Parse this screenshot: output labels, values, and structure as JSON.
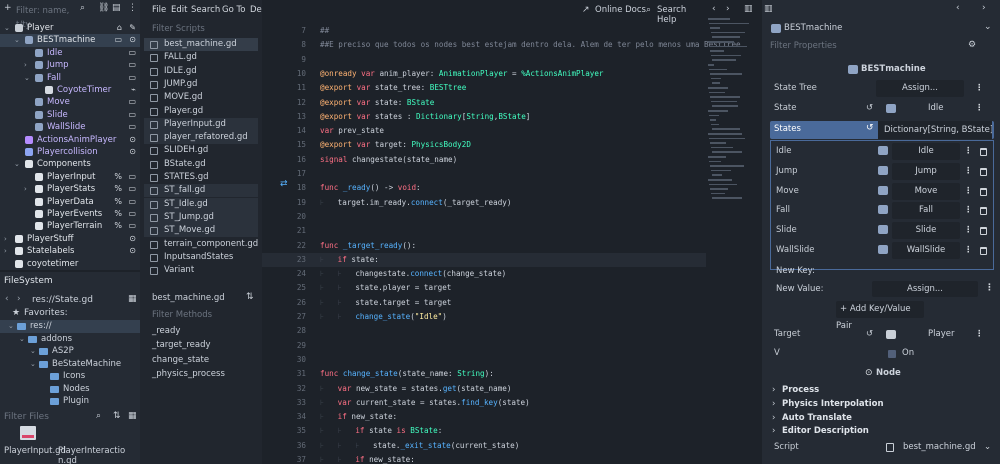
{
  "scene": {
    "filter_placeholder": "Filter: name, t/ty",
    "nodes": [
      {
        "label": "Player",
        "depth": 0,
        "color": "#e1e5ea",
        "icon": "#c9cfd7",
        "right": "✎",
        "right2": "⌂",
        "sel": false,
        "arrow": "⌄"
      },
      {
        "label": "BESTmachine",
        "depth": 1,
        "color": "#e1e5ea",
        "icon": "#8fa4c4",
        "right": "⊙",
        "right2": "▭",
        "sel": true,
        "arrow": "⌄"
      },
      {
        "label": "Idle",
        "depth": 2,
        "color": "#c7b8ff",
        "icon": "#8fa4c4",
        "right": "▭",
        "right2": "",
        "sel": false,
        "arrow": ""
      },
      {
        "label": "Jump",
        "depth": 2,
        "color": "#c7b8ff",
        "icon": "#8fa4c4",
        "right": "▭",
        "right2": "",
        "sel": false,
        "arrow": "›"
      },
      {
        "label": "Fall",
        "depth": 2,
        "color": "#c7b8ff",
        "icon": "#8fa4c4",
        "right": "▭",
        "right2": "",
        "sel": false,
        "arrow": "⌄"
      },
      {
        "label": "CoyoteTimer",
        "depth": 3,
        "color": "#c7b8ff",
        "icon": "#d6dbe2",
        "right": "⌁",
        "right2": "",
        "sel": false,
        "arrow": ""
      },
      {
        "label": "Move",
        "depth": 2,
        "color": "#c7b8ff",
        "icon": "#8fa4c4",
        "right": "▭",
        "right2": "",
        "sel": false,
        "arrow": ""
      },
      {
        "label": "Slide",
        "depth": 2,
        "color": "#c7b8ff",
        "icon": "#8fa4c4",
        "right": "▭",
        "right2": "",
        "sel": false,
        "arrow": ""
      },
      {
        "label": "WallSlide",
        "depth": 2,
        "color": "#c7b8ff",
        "icon": "#8fa4c4",
        "right": "▭",
        "right2": "",
        "sel": false,
        "arrow": ""
      },
      {
        "label": "ActionsAnimPlayer",
        "depth": 1,
        "color": "#c7b8ff",
        "icon": "#b58cff",
        "right": "⊙",
        "right2": "",
        "sel": false,
        "arrow": ""
      },
      {
        "label": "Playercollision",
        "depth": 1,
        "color": "#c7b8ff",
        "icon": "#8da5f3",
        "right": "⊙",
        "right2": "",
        "sel": false,
        "arrow": ""
      },
      {
        "label": "Components",
        "depth": 1,
        "color": "#e1e5ea",
        "icon": "#e1e5ea",
        "right": "",
        "right2": "",
        "sel": false,
        "arrow": "⌄"
      },
      {
        "label": "PlayerInput",
        "depth": 2,
        "color": "#e1e5ea",
        "icon": "#e1e5ea",
        "right": "▭",
        "right2": "%",
        "sel": false,
        "arrow": ""
      },
      {
        "label": "PlayerStats",
        "depth": 2,
        "color": "#e1e5ea",
        "icon": "#e1e5ea",
        "right": "▭",
        "right2": "%",
        "sel": false,
        "arrow": "›"
      },
      {
        "label": "PlayerData",
        "depth": 2,
        "color": "#e1e5ea",
        "icon": "#e1e5ea",
        "right": "▭",
        "right2": "%",
        "sel": false,
        "arrow": ""
      },
      {
        "label": "PlayerEvents",
        "depth": 2,
        "color": "#e1e5ea",
        "icon": "#e1e5ea",
        "right": "▭",
        "right2": "%",
        "sel": false,
        "arrow": ""
      },
      {
        "label": "PlayerTerrain",
        "depth": 2,
        "color": "#e1e5ea",
        "icon": "#e1e5ea",
        "right": "▭",
        "right2": "%",
        "sel": false,
        "arrow": ""
      },
      {
        "label": "PlayerStuff",
        "depth": 0,
        "color": "#e1e5ea",
        "icon": "#e1e5ea",
        "right": "⊙",
        "right2": "",
        "sel": false,
        "arrow": "›"
      },
      {
        "label": "Statelabels",
        "depth": 0,
        "color": "#e1e5ea",
        "icon": "#e1e5ea",
        "right": "⊙",
        "right2": "",
        "sel": false,
        "arrow": "›"
      },
      {
        "label": "coyotetimer",
        "depth": 0,
        "color": "#e1e5ea",
        "icon": "#e1e5ea",
        "right": "",
        "right2": "",
        "sel": false,
        "arrow": ""
      }
    ]
  },
  "filesystem": {
    "title": "FileSystem",
    "path": "res://State.gd",
    "favorites": "Favorites:",
    "entries": [
      {
        "label": "res://",
        "depth": 0,
        "sel": true
      },
      {
        "label": "addons",
        "depth": 1,
        "sel": false
      },
      {
        "label": "AS2P",
        "depth": 2,
        "sel": false
      },
      {
        "label": "BeStateMachine",
        "depth": 2,
        "sel": false
      },
      {
        "label": "Icons",
        "depth": 3,
        "sel": false
      },
      {
        "label": "Nodes",
        "depth": 3,
        "sel": false
      },
      {
        "label": "Plugin",
        "depth": 3,
        "sel": false
      }
    ],
    "filter_placeholder": "Filter Files",
    "thumbs": [
      "PlayerInput.gd",
      "PlayerInteractio n.gd"
    ]
  },
  "menu": [
    "File",
    "Edit",
    "Search",
    "Go To",
    "Debug"
  ],
  "top_right": {
    "online_docs": "Online Docs",
    "search_help": "Search Help"
  },
  "scripts": {
    "filter_placeholder": "Filter Scripts",
    "items": [
      "best_machine.gd",
      "FALL.gd",
      "IDLE.gd",
      "JUMP.gd",
      "MOVE.gd",
      "Player.gd",
      "PlayerInput.gd",
      "player_refatored.gd",
      "SLIDEH.gd",
      "BState.gd",
      "STATES.gd",
      "ST_fall.gd",
      "ST_Idle.gd",
      "ST_Jump.gd",
      "ST_Move.gd",
      "terrain_component.gd",
      "InputsandStates",
      "Variant"
    ],
    "current": "best_machine.gd",
    "methods_placeholder": "Filter Methods",
    "methods": [
      "_ready",
      "_target_ready",
      "change_state",
      "_physics_process"
    ]
  },
  "code": [
    {
      "n": "7",
      "t": [
        [
          "cm",
          "##"
        ]
      ]
    },
    {
      "n": "8",
      "t": [
        [
          "cm",
          "##E preciso que todos os nodes best estejam dentro dela. Alem de ter pelo menos uma BestTree"
        ]
      ]
    },
    {
      "n": "9",
      "t": []
    },
    {
      "n": "10",
      "t": [
        [
          "ann",
          "@onready"
        ],
        [
          "",
          " "
        ],
        [
          "kw",
          "var"
        ],
        [
          "",
          " anim_player: "
        ],
        [
          "ty",
          "AnimationPlayer"
        ],
        [
          "",
          " = "
        ],
        [
          "ty",
          "%ActionsAnimPlayer"
        ]
      ]
    },
    {
      "n": "11",
      "t": [
        [
          "ann",
          "@export"
        ],
        [
          "",
          " "
        ],
        [
          "kw",
          "var"
        ],
        [
          "",
          " state_tree: "
        ],
        [
          "ty",
          "BESTtree"
        ]
      ]
    },
    {
      "n": "12",
      "t": [
        [
          "ann",
          "@export"
        ],
        [
          "",
          " "
        ],
        [
          "kw",
          "var"
        ],
        [
          "",
          " state: "
        ],
        [
          "ty",
          "BState"
        ]
      ]
    },
    {
      "n": "13",
      "t": [
        [
          "ann",
          "@export"
        ],
        [
          "",
          " "
        ],
        [
          "kw",
          "var"
        ],
        [
          "",
          " states : "
        ],
        [
          "ty",
          "Dictionary"
        ],
        [
          "",
          "["
        ],
        [
          "ty",
          "String"
        ],
        [
          "",
          ","
        ],
        [
          "ty",
          "BState"
        ],
        [
          "",
          "]"
        ]
      ]
    },
    {
      "n": "14",
      "t": [
        [
          "kw",
          "var"
        ],
        [
          "",
          " prev_state"
        ]
      ]
    },
    {
      "n": "15",
      "t": [
        [
          "ann",
          "@export"
        ],
        [
          "",
          " "
        ],
        [
          "kw",
          "var"
        ],
        [
          "",
          " target: "
        ],
        [
          "ty",
          "PhysicsBody2D"
        ]
      ]
    },
    {
      "n": "16",
      "t": [
        [
          "kw",
          "signal"
        ],
        [
          "",
          " changestate(state_name)"
        ]
      ]
    },
    {
      "n": "17",
      "t": []
    },
    {
      "n": "18",
      "t": [
        [
          "kw",
          "func"
        ],
        [
          "",
          " "
        ],
        [
          "fn",
          "_ready"
        ],
        [
          "",
          "() -> "
        ],
        [
          "kw",
          "void"
        ],
        [
          "",
          ":"
        ]
      ]
    },
    {
      "n": "19",
      "t": [
        [
          "tab",
          "⊦   "
        ],
        [
          "",
          "target.im_ready."
        ],
        [
          "fn",
          "connect"
        ],
        [
          "",
          "(_target_ready)"
        ]
      ]
    },
    {
      "n": "20",
      "t": []
    },
    {
      "n": "21",
      "t": []
    },
    {
      "n": "22",
      "t": [
        [
          "kw",
          "func"
        ],
        [
          "",
          " "
        ],
        [
          "fn",
          "_target_ready"
        ],
        [
          "",
          "():"
        ]
      ]
    },
    {
      "n": "23",
      "t": [
        [
          "tab",
          "⊦   "
        ],
        [
          "kw",
          "if"
        ],
        [
          "",
          " state:"
        ]
      ],
      "cur": true
    },
    {
      "n": "24",
      "t": [
        [
          "tab",
          "⊦   ⊦   "
        ],
        [
          "",
          "changestate."
        ],
        [
          "fn",
          "connect"
        ],
        [
          "",
          "(change_state)"
        ]
      ]
    },
    {
      "n": "25",
      "t": [
        [
          "tab",
          "⊦   ⊦   "
        ],
        [
          "",
          "state.player = target"
        ]
      ]
    },
    {
      "n": "26",
      "t": [
        [
          "tab",
          "⊦   ⊦   "
        ],
        [
          "",
          "state.target = target"
        ]
      ]
    },
    {
      "n": "27",
      "t": [
        [
          "tab",
          "⊦   ⊦   "
        ],
        [
          "fn",
          "change_state"
        ],
        [
          "",
          "("
        ],
        [
          "str",
          "\"Idle\""
        ],
        [
          "",
          ")"
        ]
      ]
    },
    {
      "n": "28",
      "t": []
    },
    {
      "n": "29",
      "t": []
    },
    {
      "n": "30",
      "t": []
    },
    {
      "n": "31",
      "t": [
        [
          "kw",
          "func"
        ],
        [
          "",
          " "
        ],
        [
          "fn",
          "change_state"
        ],
        [
          "",
          "(state_name: "
        ],
        [
          "ty",
          "String"
        ],
        [
          "",
          "):"
        ]
      ]
    },
    {
      "n": "32",
      "t": [
        [
          "tab",
          "⊦   "
        ],
        [
          "kw",
          "var"
        ],
        [
          "",
          " new_state = states."
        ],
        [
          "fn",
          "get"
        ],
        [
          "",
          "(state_name)"
        ]
      ]
    },
    {
      "n": "33",
      "t": [
        [
          "tab",
          "⊦   "
        ],
        [
          "kw",
          "var"
        ],
        [
          "",
          " current_state = states."
        ],
        [
          "fn",
          "find_key"
        ],
        [
          "",
          "(state)"
        ]
      ]
    },
    {
      "n": "34",
      "t": [
        [
          "tab",
          "⊦   "
        ],
        [
          "kw",
          "if"
        ],
        [
          "",
          " new_state:"
        ]
      ]
    },
    {
      "n": "35",
      "t": [
        [
          "tab",
          "⊦   ⊦   "
        ],
        [
          "kw",
          "if"
        ],
        [
          "",
          " state "
        ],
        [
          "kw",
          "is"
        ],
        [
          "",
          " "
        ],
        [
          "ty",
          "BState"
        ],
        [
          "",
          ":"
        ]
      ]
    },
    {
      "n": "36",
      "t": [
        [
          "tab",
          "⊦   ⊦   ⊦   "
        ],
        [
          "",
          "state."
        ],
        [
          "fn",
          "_exit_state"
        ],
        [
          "",
          "(current_state)"
        ]
      ]
    },
    {
      "n": "37",
      "t": [
        [
          "tab",
          "⊦   ⊦   "
        ],
        [
          "kw",
          "if"
        ],
        [
          "",
          " new_state:"
        ]
      ]
    }
  ],
  "inspector": {
    "node_name": "BESTmachine",
    "filter_placeholder": "Filter Properties",
    "class_header": "BESTmachine",
    "state_tree_label": "State Tree",
    "state_tree_value": "Assign...",
    "state_label": "State",
    "state_value": "Idle",
    "states_label": "States",
    "states_value": "Dictionary[String, BState] (siz",
    "dict": [
      {
        "key": "Idle",
        "value": "Idle"
      },
      {
        "key": "Jump",
        "value": "Jump"
      },
      {
        "key": "Move",
        "value": "Move"
      },
      {
        "key": "Fall",
        "value": "Fall"
      },
      {
        "key": "Slide",
        "value": "Slide"
      },
      {
        "key": "WallSlide",
        "value": "WallSlide"
      }
    ],
    "new_key": "New Key:",
    "new_value": "New Value:",
    "new_value_btn": "Assign...",
    "add_pair": "Add Key/Value Pair",
    "target_label": "Target",
    "target_value": "Player",
    "v_label": "V",
    "v_value": "On",
    "node_header": "Node",
    "sections": [
      "Process",
      "Physics Interpolation",
      "Auto Translate",
      "Editor Description"
    ],
    "script_label": "Script",
    "script_value": "best_machine.gd"
  }
}
